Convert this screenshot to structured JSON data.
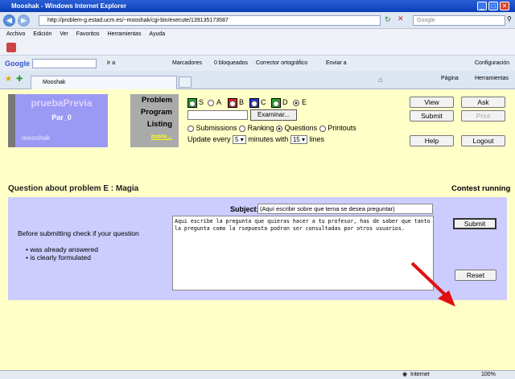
{
  "window": {
    "title": "Mooshak - Windows Internet Explorer"
  },
  "browser": {
    "url": "http://problem-g.estad.ucm.es/~mooshak/cgi-bin/execute/139135173587",
    "search_placeholder": "Google",
    "menu": [
      "Archivo",
      "Edición",
      "Ver",
      "Favoritos",
      "Herramientas",
      "Ayuda"
    ],
    "google_label": "Google",
    "google_go": "Ir a",
    "toolbar_items": [
      "Marcadores",
      "0 bloqueados",
      "Corrector ortográfico",
      "Enviar a"
    ],
    "config_label": "Configuración",
    "tab_title": "Mooshak",
    "page_menu": "Página",
    "tools_menu": "Herramientas",
    "status_zone": "Internet",
    "zoom": "100%"
  },
  "mooshak": {
    "contest_name": "pruebaPrevia",
    "user": "Par_0",
    "logo": "mooshak",
    "menu_labels": [
      "Problem",
      "Program",
      "Listing"
    ],
    "more_link": "more...",
    "problems": [
      {
        "letter": "S",
        "color": "#22aa22",
        "box": true
      },
      {
        "letter": "A",
        "color": "#ffffff",
        "box": false
      },
      {
        "letter": "B",
        "color": "#dd2222",
        "box": true
      },
      {
        "letter": "C",
        "color": "#2233dd",
        "box": true
      },
      {
        "letter": "D",
        "color": "#22aa22",
        "box": true
      },
      {
        "letter": "E",
        "color": "#ffffff",
        "box": false,
        "selected": true
      }
    ],
    "file_button": "Examinar...",
    "listing_options": [
      "Submissions",
      "Ranking",
      "Questions",
      "Printouts"
    ],
    "listing_selected": "Questions",
    "update_prefix": "Update every",
    "update_value": "5",
    "update_mid": "minutes",
    "update_with": "with",
    "lines_value": "15",
    "lines_label": "lines",
    "buttons": {
      "view": "View",
      "ask": "Ask",
      "submit": "Submit",
      "print": "Print",
      "help": "Help",
      "logout": "Logout"
    }
  },
  "question": {
    "title": "Question about problem E : Magia",
    "status": "Contest running",
    "before_text": "Before submitting check if your question",
    "bullets": [
      "was already answered",
      "is clearly formulated"
    ],
    "subject_label": "Subject:",
    "subject_value": "(Aquí escribir sobre que tema se desea preguntar)",
    "body": "Aqui escribe la pregunta que quieras hacer a tu profesor, has de saber que tanto la pregunta como la rsepuesta podran ser consultadas por otros usuarios.",
    "submit_label": "Submit",
    "reset_label": "Reset"
  },
  "colors": {
    "page_bg": "#ffffc8",
    "panel_bg": "#ccccff",
    "arrow": "#e01010"
  }
}
